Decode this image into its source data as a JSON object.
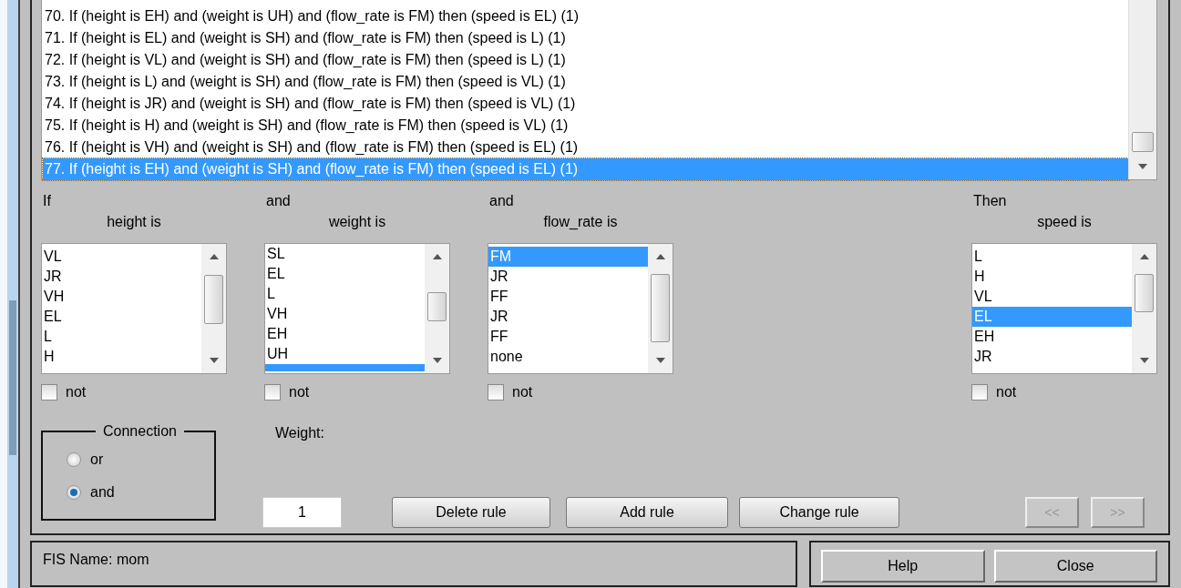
{
  "rules": {
    "items": [
      {
        "text": "70. If (height is EH) and (weight is UH) and (flow_rate is FM) then (speed is EL) (1)",
        "selected": false
      },
      {
        "text": "71. If (height is EL) and (weight is SH) and (flow_rate is FM) then (speed is L) (1)",
        "selected": false
      },
      {
        "text": "72. If (height is VL) and (weight is SH) and (flow_rate is FM) then (speed is L) (1)",
        "selected": false
      },
      {
        "text": "73. If (height is L) and (weight is SH) and (flow_rate is FM) then (speed is VL) (1)",
        "selected": false
      },
      {
        "text": "74. If (height is JR) and (weight is SH) and (flow_rate is FM) then (speed is VL) (1)",
        "selected": false
      },
      {
        "text": "75. If (height is H) and (weight is SH) and (flow_rate is FM) then (speed is VL) (1)",
        "selected": false
      },
      {
        "text": "76. If (height is VH) and (weight is SH) and (flow_rate is FM) then (speed is EL) (1)",
        "selected": false
      },
      {
        "text": "77. If (height is EH) and (weight is SH) and (flow_rate is FM) then (speed is EL) (1)",
        "selected": true
      }
    ]
  },
  "clauses": [
    {
      "kind": "antecedent",
      "connector": "If",
      "variable": "height is",
      "items": [
        {
          "label": "VL",
          "selected": false
        },
        {
          "label": "JR",
          "selected": false
        },
        {
          "label": "VH",
          "selected": false
        },
        {
          "label": "EL",
          "selected": false
        },
        {
          "label": "L",
          "selected": false
        },
        {
          "label": "H",
          "selected": false
        }
      ],
      "not": {
        "label": "not",
        "checked": false
      }
    },
    {
      "kind": "antecedent",
      "connector": "and",
      "variable": "weight is",
      "items": [
        {
          "label": "SL",
          "selected": false
        },
        {
          "label": "EL",
          "selected": false
        },
        {
          "label": "L",
          "selected": false
        },
        {
          "label": "VH",
          "selected": false
        },
        {
          "label": "EH",
          "selected": false
        },
        {
          "label": "UH",
          "selected": false
        },
        {
          "selected": true
        }
      ],
      "not": {
        "label": "not",
        "checked": false
      }
    },
    {
      "kind": "antecedent",
      "connector": "and",
      "variable": "flow_rate is",
      "items": [
        {
          "label": "FM",
          "selected": true
        },
        {
          "label": "JR",
          "selected": false
        },
        {
          "label": "FF",
          "selected": false
        },
        {
          "label": "JR",
          "selected": false
        },
        {
          "label": "FF",
          "selected": false
        },
        {
          "label": "none",
          "selected": false
        }
      ],
      "not": {
        "label": "not",
        "checked": false
      }
    },
    {
      "kind": "consequent",
      "connector": "Then",
      "variable": "speed is",
      "items": [
        {
          "label": "L",
          "selected": false
        },
        {
          "label": "H",
          "selected": false
        },
        {
          "label": "VL",
          "selected": false
        },
        {
          "label": "EL",
          "selected": true
        },
        {
          "label": "EH",
          "selected": false
        },
        {
          "label": "JR",
          "selected": false
        }
      ],
      "not": {
        "label": "not",
        "checked": false
      }
    }
  ],
  "connection": {
    "title": "Connection",
    "options": [
      {
        "label": "or",
        "selected": false
      },
      {
        "label": "and",
        "selected": true
      }
    ]
  },
  "weight": {
    "label": "Weight:",
    "value": "1"
  },
  "rule_buttons": [
    {
      "label": "Delete rule",
      "disabled": false
    },
    {
      "label": "Add rule",
      "disabled": false
    },
    {
      "label": "Change rule",
      "disabled": false
    },
    {
      "label": "<<",
      "disabled": true
    },
    {
      "label": ">>",
      "disabled": true
    }
  ],
  "status": {
    "text": "FIS Name: mom"
  },
  "dialog_buttons": [
    {
      "label": "Help"
    },
    {
      "label": "Close"
    }
  ]
}
